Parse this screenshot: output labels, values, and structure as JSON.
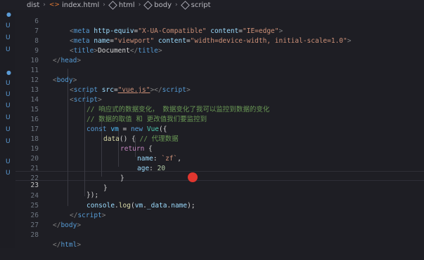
{
  "breadcrumb": {
    "items": [
      "dist",
      "index.html",
      "html",
      "body",
      "script"
    ]
  },
  "colors": {
    "background": "#1e1e24",
    "recording_dot": "#e0362f",
    "scm_marker": "#5b9bd5"
  },
  "gutter_markers": [
    "●",
    "U",
    "U",
    "U",
    "●",
    "U",
    "U",
    "U",
    "U",
    "U",
    "U",
    "U",
    "U"
  ],
  "lines": [
    {
      "num": "6"
    },
    {
      "num": "7"
    },
    {
      "num": "8"
    },
    {
      "num": "9"
    },
    {
      "num": "10"
    },
    {
      "num": "11"
    },
    {
      "num": "12"
    },
    {
      "num": "13"
    },
    {
      "num": "14"
    },
    {
      "num": "15"
    },
    {
      "num": "16"
    },
    {
      "num": "17"
    },
    {
      "num": "18"
    },
    {
      "num": "19"
    },
    {
      "num": "20"
    },
    {
      "num": "21"
    },
    {
      "num": "22"
    },
    {
      "num": "23"
    },
    {
      "num": "24"
    },
    {
      "num": "25"
    },
    {
      "num": "26"
    },
    {
      "num": "27"
    },
    {
      "num": "28"
    }
  ],
  "code": {
    "l6": {
      "a": "<",
      "b": "meta",
      "c": " http-equiv",
      "d": "=",
      "e": "\"X-UA-Compatible\"",
      "f": " content",
      "g": "=",
      "h": "\"IE=edge\"",
      "i": ">"
    },
    "l7": {
      "a": "<",
      "b": "meta",
      "c": " name",
      "d": "=",
      "e": "\"viewport\"",
      "f": " content",
      "g": "=",
      "h": "\"width=device-width, initial-scale=1.0\"",
      "i": ">"
    },
    "l8": {
      "a": "<",
      "b": "title",
      "c": ">",
      "d": "Document",
      "e": "</",
      "f": "title",
      "g": ">"
    },
    "l9": {
      "a": "</",
      "b": "head",
      "c": ">"
    },
    "l11": {
      "a": "<",
      "b": "body",
      "c": ">"
    },
    "l12": {
      "a": "<",
      "b": "script",
      "c": " src",
      "d": "=",
      "e": "\"vue.js\"",
      "f": "></",
      "g": "script",
      "h": ">"
    },
    "l13": {
      "a": "<",
      "b": "script",
      "c": ">"
    },
    "l14": "// 响应式的数据变化， 数据变化了我可以监控到数据的变化",
    "l15": "// 数据的取值 和 更改值我们要监控到",
    "l16": {
      "a": "const",
      "b": " vm",
      "c": " = ",
      "d": "new",
      "e": " Vue",
      "f": "({"
    },
    "l17": {
      "a": "data",
      "b": "() { ",
      "c": "// 代理数据"
    },
    "l18": {
      "a": "return",
      "b": " {"
    },
    "l19": {
      "a": "name",
      "b": ": ",
      "c": "`zf`",
      "d": ","
    },
    "l20": {
      "a": "age",
      "b": ": ",
      "c": "20"
    },
    "l21": "}",
    "l22": "}",
    "l23": "});",
    "l24": {
      "a": "console",
      "b": ".",
      "c": "log",
      "d": "(",
      "e": "vm",
      "f": ".",
      "g": "_data",
      "h": ".",
      "i": "name",
      "j": ");"
    },
    "l25": {
      "a": "</",
      "b": "script",
      "c": ">"
    },
    "l26": {
      "a": "</",
      "b": "body",
      "c": ">"
    },
    "l28": {
      "a": "</",
      "b": "html",
      "c": ">"
    }
  }
}
